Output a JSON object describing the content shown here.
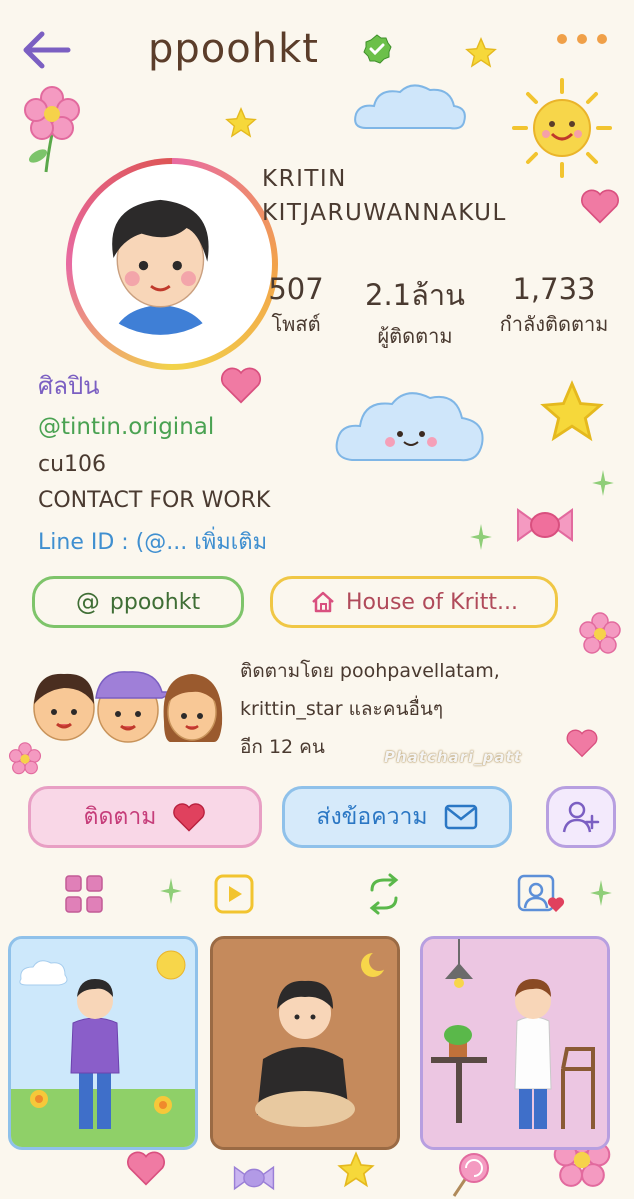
{
  "header": {
    "username": "ppoohkt",
    "back_icon": "arrow-left-icon",
    "verified_icon": "verified-badge-icon",
    "more_icon": "more-dots-icon"
  },
  "profile": {
    "name_line1": "KRITIN",
    "name_line2": "KITJARUWANNAKUL",
    "stats": [
      {
        "value": "507",
        "label": "โพสต์"
      },
      {
        "value": "2.1ล้าน",
        "label": "ผู้ติดตาม"
      },
      {
        "value": "1,733",
        "label": "กำลังติดตาม"
      }
    ]
  },
  "bio": {
    "category": "ศิลปิน",
    "handle": "@tintin.original",
    "line1": "cu106",
    "line2": "CONTACT FOR WORK",
    "line3": "Line ID : (@...",
    "more": "เพิ่มเติม"
  },
  "links": {
    "threads_label": "ppoohkt",
    "threads_icon": "threads-icon",
    "house_label": "House of Kritt...",
    "house_icon": "home-icon"
  },
  "followed_by": {
    "line1": "ติดตามโดย poohpavellatam,",
    "line2": "krittin_star และคนอื่นๆ",
    "line3": "อีก 12 คน"
  },
  "actions": {
    "follow_label": "ติดตาม",
    "message_label": "ส่งข้อความ",
    "add_user_icon": "add-user-icon"
  },
  "tabs": [
    {
      "icon": "grid-icon"
    },
    {
      "icon": "reels-play-icon"
    },
    {
      "icon": "repost-icon"
    },
    {
      "icon": "tagged-user-icon"
    }
  ],
  "watermark": "Phatchari_patt",
  "colors": {
    "background": "#fbf7ee",
    "follow_button": "#f9d7e7",
    "message_button": "#d6eafa",
    "accent_purple": "#7b5fc2",
    "accent_green": "#4aa252",
    "accent_blue": "#3f8fd0"
  }
}
